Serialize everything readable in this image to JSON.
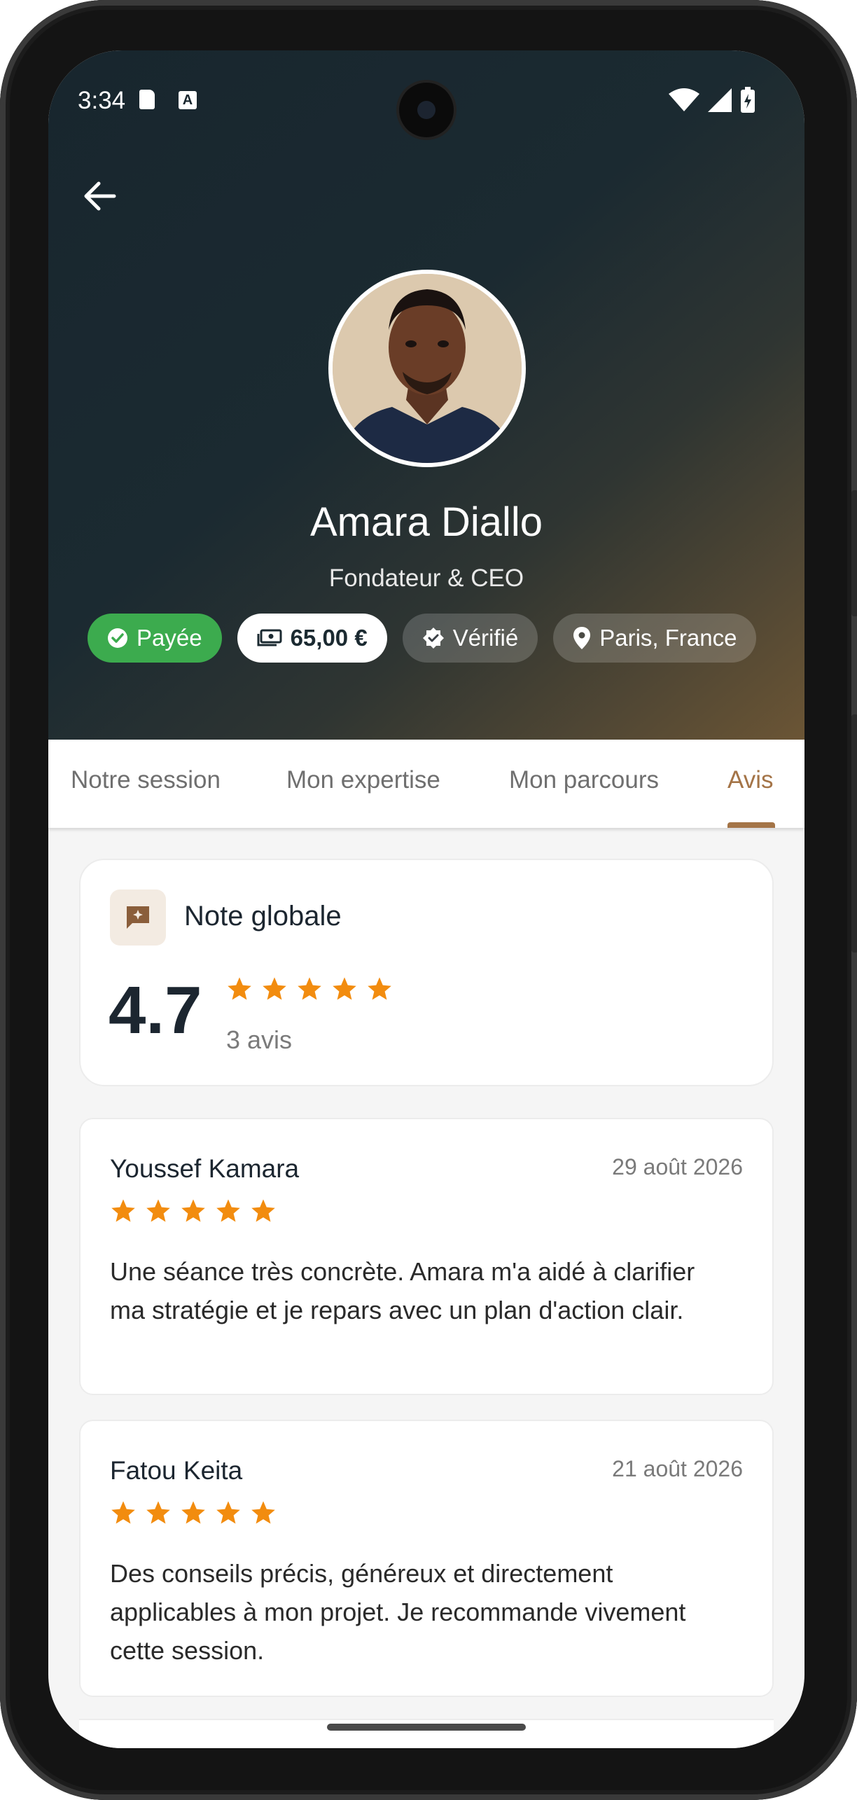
{
  "status_bar": {
    "time": "3:34"
  },
  "header": {
    "back_label": "back",
    "name": "Amara Diallo",
    "role": "Fondateur & CEO",
    "chips": {
      "paid": "Payée",
      "price": "65,00 €",
      "verified": "Vérifié",
      "location": "Paris, France"
    }
  },
  "tabs": [
    {
      "label": "Notre session",
      "active": false
    },
    {
      "label": "Mon expertise",
      "active": false
    },
    {
      "label": "Mon parcours",
      "active": false
    },
    {
      "label": "Avis",
      "active": true
    }
  ],
  "rating": {
    "title": "Note globale",
    "score": "4.7",
    "stars": 5,
    "count": "3 avis"
  },
  "reviews": [
    {
      "author": "Youssef Kamara",
      "date": "29 août 2026",
      "stars": 5,
      "text": "Une séance très concrète. Amara m'a aidé à clarifier ma stratégie et je repars avec un plan d'action clair."
    },
    {
      "author": "Fatou Keita",
      "date": "21 août 2026",
      "stars": 5,
      "text": "Des conseils précis, généreux et directement applicables à mon projet. Je recommande vivement cette session."
    }
  ],
  "colors": {
    "accent": "#a47447",
    "star": "#f28c0f",
    "paid": "#3cab4e",
    "text_dark": "#1c2630"
  }
}
